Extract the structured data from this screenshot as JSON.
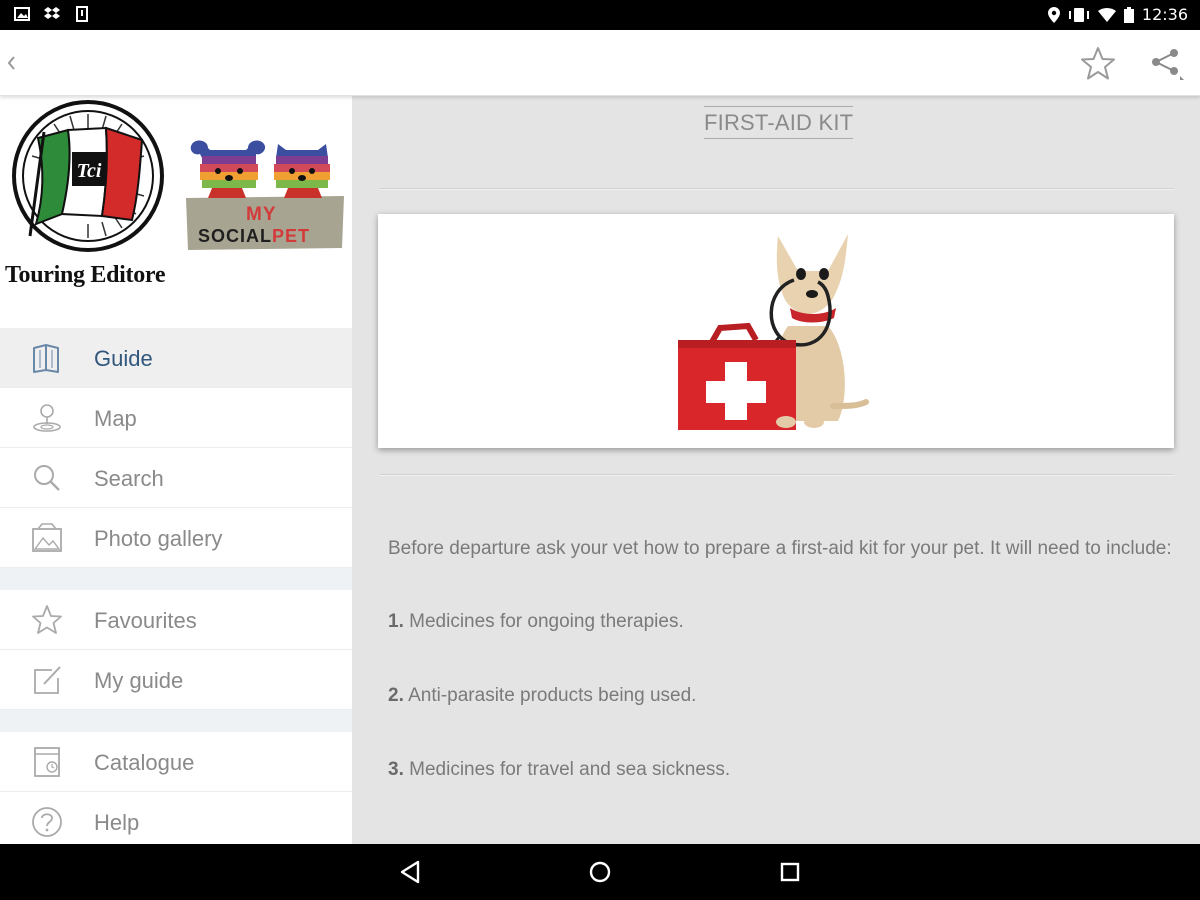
{
  "status_bar": {
    "time": "12:36"
  },
  "app_bar": {
    "back_icon": "chevron-left-icon",
    "favourite_icon": "star-outline-icon",
    "share_icon": "share-icon"
  },
  "drawer": {
    "publisher": "Touring Editore",
    "logo_lettering": "Tci",
    "partner_logo_lettering": [
      "MY",
      "SOCIAL",
      "PET"
    ],
    "menu_groups": [
      [
        {
          "label": "Guide",
          "icon": "book-icon",
          "active": true
        },
        {
          "label": "Map",
          "icon": "map-pin-icon",
          "active": false
        },
        {
          "label": "Search",
          "icon": "search-icon",
          "active": false
        },
        {
          "label": "Photo gallery",
          "icon": "image-icon",
          "active": false
        }
      ],
      [
        {
          "label": "Favourites",
          "icon": "star-icon",
          "active": false
        },
        {
          "label": "My guide",
          "icon": "edit-icon",
          "active": false
        }
      ],
      [
        {
          "label": "Catalogue",
          "icon": "catalogue-icon",
          "active": false
        },
        {
          "label": "Help",
          "icon": "help-icon",
          "active": false
        }
      ]
    ]
  },
  "content": {
    "title": "FIRST-AID KIT",
    "intro": "Before departure ask your vet how to prepare a first-aid kit for your pet. It will need to include:",
    "list": [
      {
        "num": "1.",
        "text": "Medicines for ongoing therapies."
      },
      {
        "num": "2.",
        "text": "Anti-parasite products being used."
      },
      {
        "num": "3.",
        "text": "Medicines for travel and sea sickness."
      }
    ]
  },
  "nav_bar": {
    "back_icon": "triangle-back-icon",
    "home_icon": "circle-home-icon",
    "recents_icon": "square-recents-icon"
  }
}
